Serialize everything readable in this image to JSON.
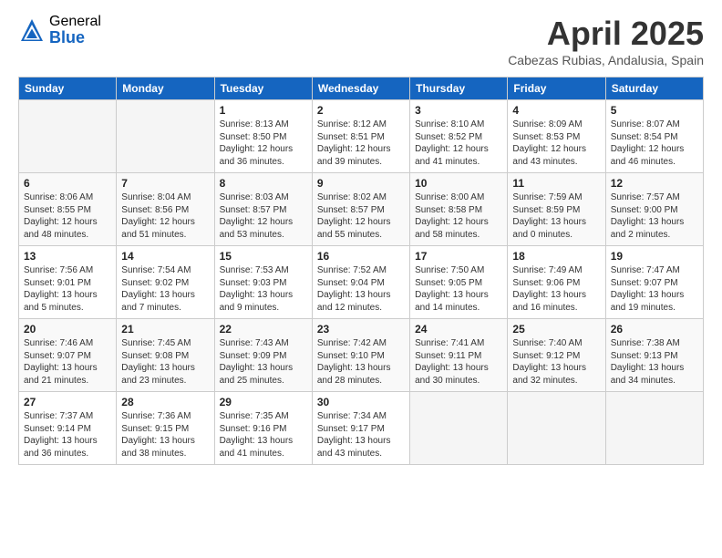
{
  "header": {
    "logo_general": "General",
    "logo_blue": "Blue",
    "month_title": "April 2025",
    "location": "Cabezas Rubias, Andalusia, Spain"
  },
  "columns": [
    "Sunday",
    "Monday",
    "Tuesday",
    "Wednesday",
    "Thursday",
    "Friday",
    "Saturday"
  ],
  "weeks": [
    [
      {
        "day": "",
        "info": ""
      },
      {
        "day": "",
        "info": ""
      },
      {
        "day": "1",
        "info": "Sunrise: 8:13 AM\nSunset: 8:50 PM\nDaylight: 12 hours\nand 36 minutes."
      },
      {
        "day": "2",
        "info": "Sunrise: 8:12 AM\nSunset: 8:51 PM\nDaylight: 12 hours\nand 39 minutes."
      },
      {
        "day": "3",
        "info": "Sunrise: 8:10 AM\nSunset: 8:52 PM\nDaylight: 12 hours\nand 41 minutes."
      },
      {
        "day": "4",
        "info": "Sunrise: 8:09 AM\nSunset: 8:53 PM\nDaylight: 12 hours\nand 43 minutes."
      },
      {
        "day": "5",
        "info": "Sunrise: 8:07 AM\nSunset: 8:54 PM\nDaylight: 12 hours\nand 46 minutes."
      }
    ],
    [
      {
        "day": "6",
        "info": "Sunrise: 8:06 AM\nSunset: 8:55 PM\nDaylight: 12 hours\nand 48 minutes."
      },
      {
        "day": "7",
        "info": "Sunrise: 8:04 AM\nSunset: 8:56 PM\nDaylight: 12 hours\nand 51 minutes."
      },
      {
        "day": "8",
        "info": "Sunrise: 8:03 AM\nSunset: 8:57 PM\nDaylight: 12 hours\nand 53 minutes."
      },
      {
        "day": "9",
        "info": "Sunrise: 8:02 AM\nSunset: 8:57 PM\nDaylight: 12 hours\nand 55 minutes."
      },
      {
        "day": "10",
        "info": "Sunrise: 8:00 AM\nSunset: 8:58 PM\nDaylight: 12 hours\nand 58 minutes."
      },
      {
        "day": "11",
        "info": "Sunrise: 7:59 AM\nSunset: 8:59 PM\nDaylight: 13 hours\nand 0 minutes."
      },
      {
        "day": "12",
        "info": "Sunrise: 7:57 AM\nSunset: 9:00 PM\nDaylight: 13 hours\nand 2 minutes."
      }
    ],
    [
      {
        "day": "13",
        "info": "Sunrise: 7:56 AM\nSunset: 9:01 PM\nDaylight: 13 hours\nand 5 minutes."
      },
      {
        "day": "14",
        "info": "Sunrise: 7:54 AM\nSunset: 9:02 PM\nDaylight: 13 hours\nand 7 minutes."
      },
      {
        "day": "15",
        "info": "Sunrise: 7:53 AM\nSunset: 9:03 PM\nDaylight: 13 hours\nand 9 minutes."
      },
      {
        "day": "16",
        "info": "Sunrise: 7:52 AM\nSunset: 9:04 PM\nDaylight: 13 hours\nand 12 minutes."
      },
      {
        "day": "17",
        "info": "Sunrise: 7:50 AM\nSunset: 9:05 PM\nDaylight: 13 hours\nand 14 minutes."
      },
      {
        "day": "18",
        "info": "Sunrise: 7:49 AM\nSunset: 9:06 PM\nDaylight: 13 hours\nand 16 minutes."
      },
      {
        "day": "19",
        "info": "Sunrise: 7:47 AM\nSunset: 9:07 PM\nDaylight: 13 hours\nand 19 minutes."
      }
    ],
    [
      {
        "day": "20",
        "info": "Sunrise: 7:46 AM\nSunset: 9:07 PM\nDaylight: 13 hours\nand 21 minutes."
      },
      {
        "day": "21",
        "info": "Sunrise: 7:45 AM\nSunset: 9:08 PM\nDaylight: 13 hours\nand 23 minutes."
      },
      {
        "day": "22",
        "info": "Sunrise: 7:43 AM\nSunset: 9:09 PM\nDaylight: 13 hours\nand 25 minutes."
      },
      {
        "day": "23",
        "info": "Sunrise: 7:42 AM\nSunset: 9:10 PM\nDaylight: 13 hours\nand 28 minutes."
      },
      {
        "day": "24",
        "info": "Sunrise: 7:41 AM\nSunset: 9:11 PM\nDaylight: 13 hours\nand 30 minutes."
      },
      {
        "day": "25",
        "info": "Sunrise: 7:40 AM\nSunset: 9:12 PM\nDaylight: 13 hours\nand 32 minutes."
      },
      {
        "day": "26",
        "info": "Sunrise: 7:38 AM\nSunset: 9:13 PM\nDaylight: 13 hours\nand 34 minutes."
      }
    ],
    [
      {
        "day": "27",
        "info": "Sunrise: 7:37 AM\nSunset: 9:14 PM\nDaylight: 13 hours\nand 36 minutes."
      },
      {
        "day": "28",
        "info": "Sunrise: 7:36 AM\nSunset: 9:15 PM\nDaylight: 13 hours\nand 38 minutes."
      },
      {
        "day": "29",
        "info": "Sunrise: 7:35 AM\nSunset: 9:16 PM\nDaylight: 13 hours\nand 41 minutes."
      },
      {
        "day": "30",
        "info": "Sunrise: 7:34 AM\nSunset: 9:17 PM\nDaylight: 13 hours\nand 43 minutes."
      },
      {
        "day": "",
        "info": ""
      },
      {
        "day": "",
        "info": ""
      },
      {
        "day": "",
        "info": ""
      }
    ]
  ]
}
